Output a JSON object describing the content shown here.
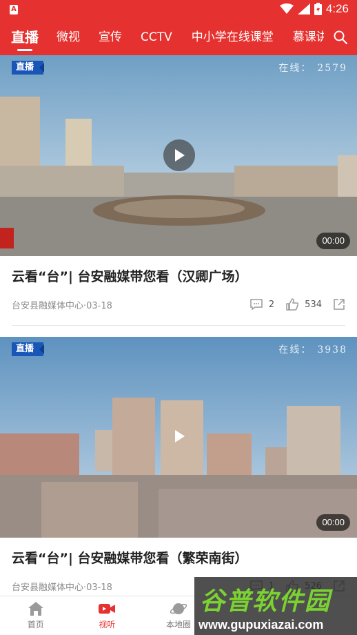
{
  "status_bar": {
    "time": "4:26"
  },
  "top_tabs": [
    {
      "label": "直播",
      "active": true
    },
    {
      "label": "微视",
      "active": false
    },
    {
      "label": "宣传",
      "active": false
    },
    {
      "label": "CCTV",
      "active": false
    },
    {
      "label": "中小学在线课堂",
      "active": false
    },
    {
      "label": "慕课讲堂",
      "active": false
    }
  ],
  "search_icon": "search-icon",
  "videos": [
    {
      "badge": "直播",
      "online_label": "在线：",
      "online_count": "2579",
      "duration": "00:00",
      "title": "云看“台”| 台安融媒带您看（汉卿广场）",
      "source": "台安县融媒体中心·03-18",
      "comments": "2",
      "likes": "534"
    },
    {
      "badge": "直播",
      "online_label": "在线：",
      "online_count": "3938",
      "duration": "00:00",
      "title": "云看“台”| 台安融媒带您看（繁荣南街）",
      "source": "台安县融媒体中心·03-18",
      "comments": "1",
      "likes": "526"
    }
  ],
  "bottom_nav": [
    {
      "label": "首页",
      "icon": "home-icon",
      "active": false
    },
    {
      "label": "视听",
      "icon": "video-icon",
      "active": true
    },
    {
      "label": "本地圈",
      "icon": "planet-icon",
      "active": false
    },
    {
      "label": "",
      "icon": "",
      "active": false
    },
    {
      "label": "",
      "icon": "",
      "active": false
    }
  ],
  "watermark": {
    "title": "谷普软件园",
    "url": "www.gupuxiazai.com"
  },
  "colors": {
    "brand_red": "#e5312f",
    "live_blue": "#1a56b8",
    "watermark_green": "#7bd331"
  }
}
